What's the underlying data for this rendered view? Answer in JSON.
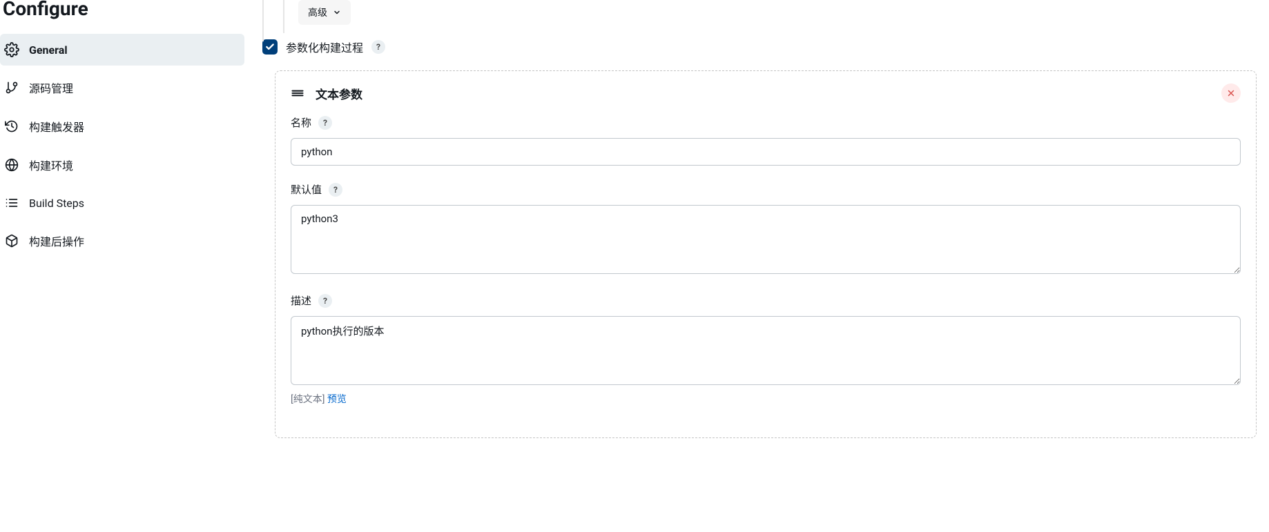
{
  "page_title": "Configure",
  "sidebar": {
    "items": [
      {
        "label": "General",
        "active": true
      },
      {
        "label": "源码管理",
        "active": false
      },
      {
        "label": "构建触发器",
        "active": false
      },
      {
        "label": "构建环境",
        "active": false
      },
      {
        "label": "Build Steps",
        "active": false
      },
      {
        "label": "构建后操作",
        "active": false
      }
    ]
  },
  "top": {
    "advanced_label": "高级"
  },
  "checkbox": {
    "label": "参数化构建过程",
    "checked": true
  },
  "param": {
    "title": "文本参数",
    "name_label": "名称",
    "name_value": "python",
    "default_label": "默认值",
    "default_value": "python3",
    "desc_label": "描述",
    "desc_value": "python执行的版本",
    "footer_plain": "[纯文本]",
    "footer_preview": "预览"
  },
  "help_glyph": "?"
}
